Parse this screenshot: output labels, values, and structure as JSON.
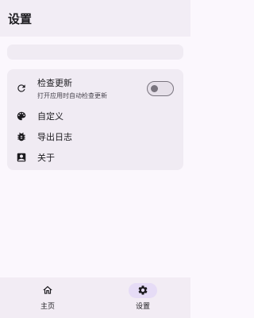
{
  "header": {
    "title": "设置"
  },
  "settings": {
    "check_update": {
      "label": "检查更新",
      "description": "打开应用时自动检查更新",
      "enabled": false,
      "icon": "refresh-icon"
    },
    "customize": {
      "label": "自定义",
      "icon": "palette-icon"
    },
    "export_log": {
      "label": "导出日志",
      "icon": "bug-icon"
    },
    "about": {
      "label": "关于",
      "icon": "account-box-icon"
    }
  },
  "bottom_nav": {
    "items": [
      {
        "label": "主页",
        "icon": "home-icon",
        "active": false
      },
      {
        "label": "设置",
        "icon": "gear-icon",
        "active": true
      }
    ]
  },
  "colors": {
    "background": "#fbf7fd",
    "surface": "#f0ebf3",
    "nav_active": "#e6dcf6",
    "outline": "#79747e"
  }
}
